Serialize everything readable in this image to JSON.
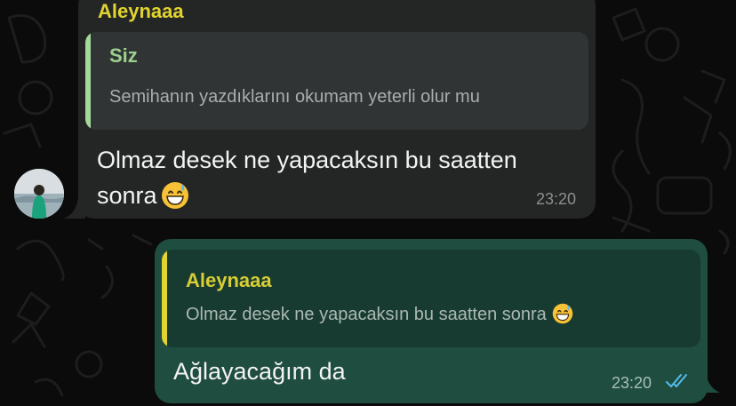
{
  "incoming": {
    "sender": "Aleynaaa",
    "reply": {
      "name": "Siz",
      "text": "Semihanın yazdıklarını okumam yeterli olur mu"
    },
    "text": "Olmaz desek ne yapacaksın bu saatten sonra",
    "emoji": "grinning-face-with-sweat",
    "time": "23:20"
  },
  "outgoing": {
    "reply": {
      "name": "Aleynaaa",
      "text": "Olmaz desek ne yapacaksın bu saatten sonra",
      "emoji": "grinning-face-with-sweat"
    },
    "text": "Ağlayacağım da",
    "time": "23:20",
    "status": "read-double-check"
  },
  "colors": {
    "incoming_bubble": "#242626",
    "outgoing_bubble": "#1f4d40",
    "sender_name": "#e1d430",
    "self_quote_name": "#9bd08f",
    "read_ticks": "#53bdeb"
  }
}
